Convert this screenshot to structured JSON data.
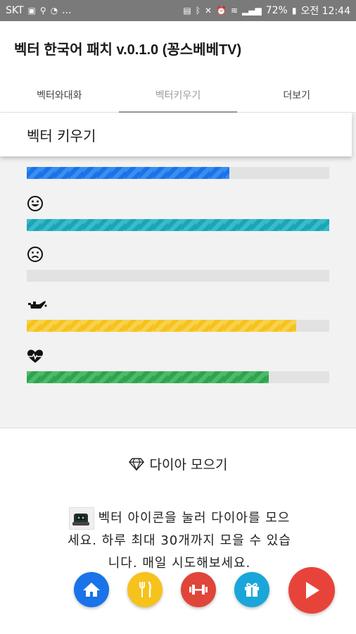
{
  "status_bar": {
    "carrier": "SKT",
    "battery": "72%",
    "time": "오전 12:44",
    "overflow": "...",
    "bg_color": "#7a7a7a"
  },
  "app": {
    "title": "벡터 한국어 패치 v.0.1.0 (꽁스베베TV)"
  },
  "tabs": [
    {
      "label": "벡터와대화",
      "active": false
    },
    {
      "label": "벡터키우기",
      "active": true
    },
    {
      "label": "더보기",
      "active": false
    }
  ],
  "section": {
    "title": "벡터 키우기"
  },
  "stats": [
    {
      "icon": "vector-icon",
      "level": 0.67,
      "color": "#1a73e8",
      "stripe": "#3d8cf0"
    },
    {
      "icon": "smile-icon",
      "level": 1.0,
      "color": "#1aa6b7",
      "stripe": "#3bbac9"
    },
    {
      "icon": "sad-icon",
      "level": 0.0,
      "color": "#dc3545",
      "stripe": "#e35d6a"
    },
    {
      "icon": "oil-can-icon",
      "level": 0.89,
      "color": "#f6c21c",
      "stripe": "#f8d24d"
    },
    {
      "icon": "heartbeat-icon",
      "level": 0.8,
      "color": "#2ea44f",
      "stripe": "#4dba6a"
    }
  ],
  "diamond": {
    "icon": "diamond-icon",
    "title": "다이아 모으기",
    "desc_line1": "벡터 아이콘을 눌러 다이아를 모으",
    "desc_line2": "세요. 하루 최대 30개까지 모을 수 있습",
    "desc_line3": "니다. 매일 시도해보세요."
  },
  "bottom_buttons": [
    {
      "name": "home-button",
      "icon": "home-icon",
      "color": "#1a73e8"
    },
    {
      "name": "feed-button",
      "icon": "fork-knife-icon",
      "color": "#f6c21c"
    },
    {
      "name": "exercise-button",
      "icon": "dumbbell-icon",
      "color": "#e0453a"
    },
    {
      "name": "gift-button",
      "icon": "gift-icon",
      "color": "#1aa6d8"
    },
    {
      "name": "play-button",
      "icon": "play-icon",
      "color": "#e8433a"
    }
  ]
}
